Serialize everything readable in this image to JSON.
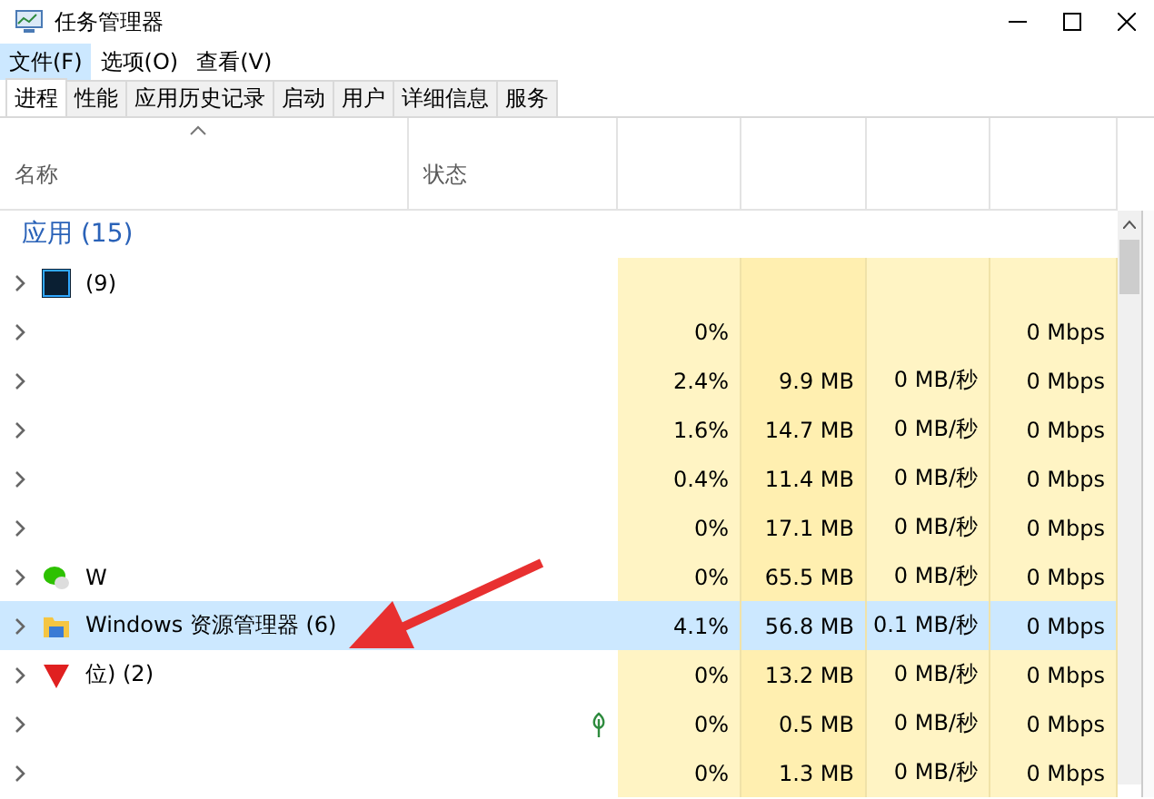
{
  "window": {
    "title": "任务管理器"
  },
  "menu": [
    {
      "label": "文件(F)",
      "selected": true
    },
    {
      "label": "选项(O)",
      "selected": false
    },
    {
      "label": "查看(V)",
      "selected": false
    }
  ],
  "tabs": [
    {
      "label": "进程",
      "selected": true
    },
    {
      "label": "性能",
      "selected": false
    },
    {
      "label": "应用历史记录",
      "selected": false
    },
    {
      "label": "启动",
      "selected": false
    },
    {
      "label": "用户",
      "selected": false
    },
    {
      "label": "详细信息",
      "selected": false
    },
    {
      "label": "服务",
      "selected": false
    }
  ],
  "columns": {
    "name": "名称",
    "status": "状态"
  },
  "group": {
    "label": "应用 (15)"
  },
  "rows": [
    {
      "name": "(9)",
      "selected": false,
      "suspended": false
    },
    {
      "selected": false,
      "suspended": false,
      "cpu": "0%",
      "network": "0 Mbps"
    },
    {
      "selected": false,
      "suspended": false,
      "cpu": "2.4%",
      "memory": "9.9 MB",
      "disk": "0 MB/秒",
      "network": "0 Mbps"
    },
    {
      "selected": false,
      "suspended": false,
      "cpu": "1.6%",
      "memory": "14.7 MB",
      "disk": "0 MB/秒",
      "network": "0 Mbps"
    },
    {
      "selected": false,
      "suspended": false,
      "cpu": "0.4%",
      "memory": "11.4 MB",
      "disk": "0 MB/秒",
      "network": "0 Mbps"
    },
    {
      "selected": false,
      "suspended": false,
      "cpu": "0%",
      "memory": "17.1 MB",
      "disk": "0 MB/秒",
      "network": "0 Mbps"
    },
    {
      "name": "W",
      "selected": false,
      "suspended": false,
      "cpu": "0%",
      "memory": "65.5 MB",
      "disk": "0 MB/秒",
      "network": "0 Mbps"
    },
    {
      "name": "Windows 资源管理器 (6)",
      "selected": true,
      "suspended": false,
      "cpu": "4.1%",
      "memory": "56.8 MB",
      "disk": "0.1 MB/秒",
      "network": "0 Mbps"
    },
    {
      "name": "位) (2)",
      "selected": false,
      "suspended": false,
      "cpu": "0%",
      "memory": "13.2 MB",
      "disk": "0 MB/秒",
      "network": "0 Mbps"
    },
    {
      "selected": false,
      "suspended": true,
      "cpu": "0%",
      "memory": "0.5 MB",
      "disk": "0 MB/秒",
      "network": "0 Mbps"
    },
    {
      "selected": false,
      "suspended": false,
      "cpu": "0%",
      "memory": "1.3 MB",
      "disk": "0 MB/秒",
      "network": "0 Mbps"
    }
  ]
}
